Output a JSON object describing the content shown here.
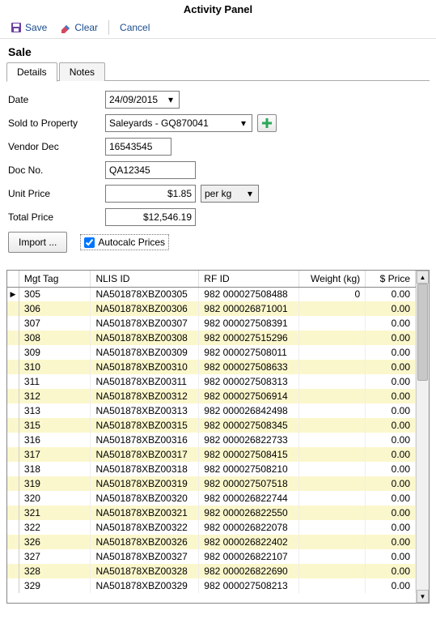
{
  "window_title": "Activity Panel",
  "toolbar": {
    "save_label": "Save",
    "clear_label": "Clear",
    "cancel_label": "Cancel"
  },
  "section_title": "Sale",
  "tabs": {
    "details": "Details",
    "notes": "Notes"
  },
  "form": {
    "date_label": "Date",
    "date_value": "24/09/2015",
    "sold_to_label": "Sold to Property",
    "sold_to_value": "Saleyards - GQ870041",
    "vendor_label": "Vendor Dec",
    "vendor_value": "16543545",
    "doc_label": "Doc No.",
    "doc_value": "QA12345",
    "unit_price_label": "Unit Price",
    "unit_price_value": "$1.85",
    "unit_combo_value": "per kg",
    "total_price_label": "Total Price",
    "total_price_value": "$12,546.19",
    "import_label": "Import ...",
    "autocalc_label": "Autocalc Prices",
    "autocalc_checked": true
  },
  "grid": {
    "headers": {
      "mgt_tag": "Mgt Tag",
      "nlis": "NLIS ID",
      "rfid": "RF ID",
      "weight": "Weight (kg)",
      "price": "$ Price"
    },
    "rows": [
      {
        "tag": "305",
        "nlis": "NA501878XBZ00305",
        "rfid": "982 000027508488",
        "weight": "0",
        "price": "0.00"
      },
      {
        "tag": "306",
        "nlis": "NA501878XBZ00306",
        "rfid": "982 000026871001",
        "weight": "",
        "price": "0.00"
      },
      {
        "tag": "307",
        "nlis": "NA501878XBZ00307",
        "rfid": "982 000027508391",
        "weight": "",
        "price": "0.00"
      },
      {
        "tag": "308",
        "nlis": "NA501878XBZ00308",
        "rfid": "982 000027515296",
        "weight": "",
        "price": "0.00"
      },
      {
        "tag": "309",
        "nlis": "NA501878XBZ00309",
        "rfid": "982 000027508011",
        "weight": "",
        "price": "0.00"
      },
      {
        "tag": "310",
        "nlis": "NA501878XBZ00310",
        "rfid": "982 000027508633",
        "weight": "",
        "price": "0.00"
      },
      {
        "tag": "311",
        "nlis": "NA501878XBZ00311",
        "rfid": "982 000027508313",
        "weight": "",
        "price": "0.00"
      },
      {
        "tag": "312",
        "nlis": "NA501878XBZ00312",
        "rfid": "982 000027506914",
        "weight": "",
        "price": "0.00"
      },
      {
        "tag": "313",
        "nlis": "NA501878XBZ00313",
        "rfid": "982 000026842498",
        "weight": "",
        "price": "0.00"
      },
      {
        "tag": "315",
        "nlis": "NA501878XBZ00315",
        "rfid": "982 000027508345",
        "weight": "",
        "price": "0.00"
      },
      {
        "tag": "316",
        "nlis": "NA501878XBZ00316",
        "rfid": "982 000026822733",
        "weight": "",
        "price": "0.00"
      },
      {
        "tag": "317",
        "nlis": "NA501878XBZ00317",
        "rfid": "982 000027508415",
        "weight": "",
        "price": "0.00"
      },
      {
        "tag": "318",
        "nlis": "NA501878XBZ00318",
        "rfid": "982 000027508210",
        "weight": "",
        "price": "0.00"
      },
      {
        "tag": "319",
        "nlis": "NA501878XBZ00319",
        "rfid": "982 000027507518",
        "weight": "",
        "price": "0.00"
      },
      {
        "tag": "320",
        "nlis": "NA501878XBZ00320",
        "rfid": "982 000026822744",
        "weight": "",
        "price": "0.00"
      },
      {
        "tag": "321",
        "nlis": "NA501878XBZ00321",
        "rfid": "982 000026822550",
        "weight": "",
        "price": "0.00"
      },
      {
        "tag": "322",
        "nlis": "NA501878XBZ00322",
        "rfid": "982 000026822078",
        "weight": "",
        "price": "0.00"
      },
      {
        "tag": "326",
        "nlis": "NA501878XBZ00326",
        "rfid": "982 000026822402",
        "weight": "",
        "price": "0.00"
      },
      {
        "tag": "327",
        "nlis": "NA501878XBZ00327",
        "rfid": "982 000026822107",
        "weight": "",
        "price": "0.00"
      },
      {
        "tag": "328",
        "nlis": "NA501878XBZ00328",
        "rfid": "982 000026822690",
        "weight": "",
        "price": "0.00"
      },
      {
        "tag": "329",
        "nlis": "NA501878XBZ00329",
        "rfid": "982 000027508213",
        "weight": "",
        "price": "0.00"
      }
    ]
  }
}
